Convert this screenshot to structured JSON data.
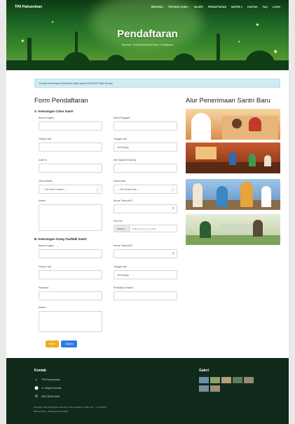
{
  "brand": "TPA Pakuomban",
  "nav": [
    "BERANDA",
    "TENTANG KAMI",
    "GALERI",
    "PENDAFTARAN",
    "MATERI",
    "KONTAK",
    "FAQ",
    "LOGIN"
  ],
  "nav_dropdowns": [
    "TENTANG KAMI",
    "MATERI"
  ],
  "hero": {
    "title": "Pendaftaran",
    "crumb_home": "Beranda",
    "crumb_mid": "Penerimaan Santri Baru",
    "crumb_current": "Pendaftaran"
  },
  "notice": "Periode Penerimaan Santri Baru Tahun Ajaran 2019/2020 Telah Dimulai",
  "form": {
    "title": "Form Pendaftaran",
    "section_a": "A. Keterangan Calon Santri",
    "section_b": "B. Keterangan Orang Tua/Wali Santri",
    "a": {
      "nama_lengkap": "Nama Lengkap",
      "nama_panggilan": "Nama Panggilan",
      "tempat_lahir": "Tempat Lahir",
      "tanggal_lahir": "Tanggal Lahir",
      "tanggal_placeholder": "mm/dd/yyyy",
      "anak_ke": "Anak Ke",
      "dari_saudara": "Dari Saudara Kandung",
      "jenis_kelamin": "Jenis Kelamin",
      "jenis_kelamin_value": "--- Pilih Jenis Kelamin ---",
      "status_anak": "Status Anak",
      "status_anak_value": "--- Pilih Status Anak ---",
      "alamat": "Alamat",
      "nomor_telepon": "Nomor Telepon/HP",
      "pas_foto": "Pas Foto",
      "file_button": "Telusuri...",
      "file_text": "Tidak ada file yang dipilih."
    },
    "b": {
      "nama_lengkap": "Nama Lengkap",
      "nomor_telepon": "Nomor Telepon/HP",
      "tempat_lahir": "Tempat Lahir",
      "tanggal_lahir": "Tanggal Lahir",
      "tanggal_placeholder": "mm/dd/yyyy",
      "pekerjaan": "Pekerjaan",
      "pendidikan": "Pendidikan Terakhir",
      "alamat": "Alamat"
    },
    "btn_reset": "Reset",
    "btn_submit": "Submit"
  },
  "alur": {
    "title": "Alur Penerimaan Santri Baru"
  },
  "footer": {
    "kontak_title": "Kontak",
    "name": "TPA Pakuomban",
    "address": "Jl. Masjid Rahmat",
    "phone": "0822-8000-0500",
    "copy_line1": "Copyright ©2019 All rights reserved | This template is made with ♡ by Colorlib",
    "copy_line2": "PakuomTech – Didi Argantono Adam",
    "galeri_title": "Galeri"
  },
  "colors": {
    "hero_dark": "#0d3a14",
    "notice_bg": "#cfecf2",
    "reset": "#f0ad1c",
    "submit": "#2d7de0",
    "footer": "#0f2a1a"
  }
}
